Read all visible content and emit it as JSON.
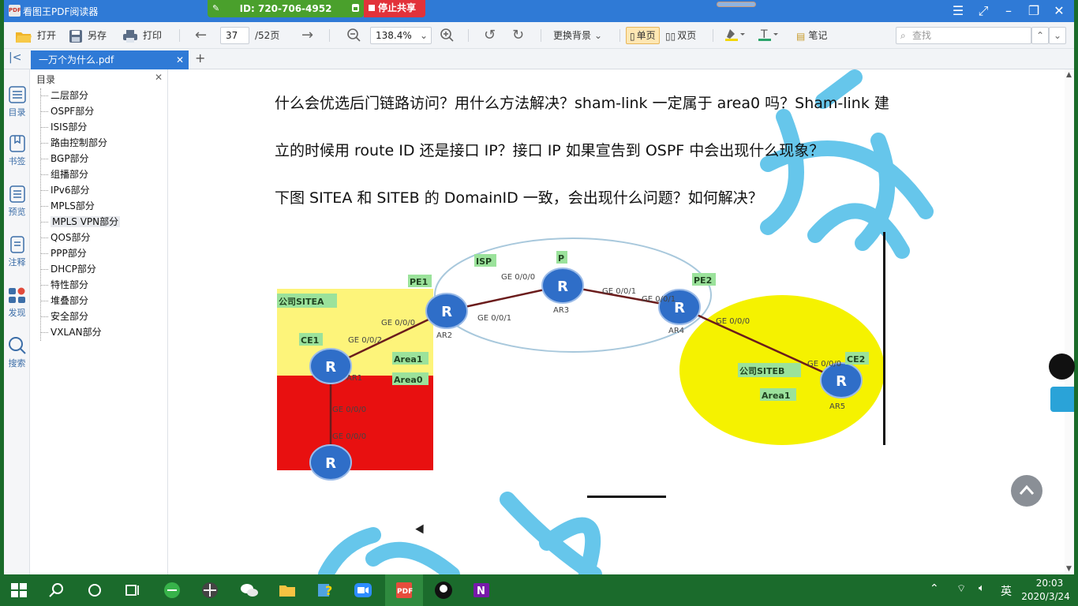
{
  "app": {
    "title": "看图王PDF阅读器",
    "logo_text": "PDF"
  },
  "share": {
    "id_label": "ID: 720-706-4952",
    "stop_label": "停止共享"
  },
  "toolbar": {
    "open": "打开",
    "save_as": "另存",
    "print": "打印",
    "page_current": "37",
    "page_total": "/52页",
    "zoom": "138.4%",
    "background": "更换背景",
    "single_page": "单页",
    "double_page": "双页",
    "notes": "笔记",
    "search_placeholder": "查找"
  },
  "tab": {
    "filename": "一万个为什么.pdf"
  },
  "sidebar": {
    "items": [
      "目录",
      "书签",
      "预览",
      "注释",
      "发现",
      "搜索"
    ]
  },
  "toc": {
    "title": "目录",
    "items": [
      "二层部分",
      "OSPF部分",
      "ISIS部分",
      "路由控制部分",
      "BGP部分",
      "组播部分",
      "IPv6部分",
      "MPLS部分",
      "MPLS VPN部分",
      "QOS部分",
      "PPP部分",
      "DHCP部分",
      "特性部分",
      "堆叠部分",
      "安全部分",
      "VXLAN部分"
    ],
    "selected_index": 8
  },
  "page": {
    "line1": "什么会优选后门链路访问？用什么方法解决？sham-link 一定属于 area0 吗？Sham-link 建",
    "line2": "立的时候用 route ID 还是接口 IP？接口 IP 如果宣告到 OSPF 中会出现什么现象？",
    "line3": "下图 SITEA 和 SITEB 的 DomainID 一致，会出现什么问题？如何解决？"
  },
  "diagram": {
    "isp": "ISP",
    "p": "P",
    "pe1": "PE1",
    "pe2": "PE2",
    "ce1": "CE1",
    "ce2": "CE2",
    "site_a": "公司SITEA",
    "site_b": "公司SITEB",
    "area1_a": "Area1",
    "area0_a": "Area0",
    "area1_b": "Area1",
    "ar1": "AR1",
    "ar2": "AR2",
    "ar3": "AR3",
    "ar4": "AR4",
    "ar5": "AR5",
    "ge1": "GE 0/0/0",
    "ge2": "GE 0/0/2",
    "ge3": "GE 0/0/0",
    "ge4": "GE 0/0/1",
    "ge5": "GE 0/0/0",
    "ge6": "GE 0/0/1",
    "ge7": "GE 0/0/1",
    "ge8": "GE 0/0/0",
    "ge9": "GE 0/0/0",
    "ge10": "GE 0/0/0",
    "ge11": "GE 0/0/0"
  },
  "taskbar": {
    "time": "20:03",
    "date": "2020/3/24",
    "ime": "英"
  },
  "colors": {
    "titlebar": "#2f7ad6",
    "taskbar": "#1b6b2c",
    "stop_share": "#e2323a",
    "share_id": "#4aa02c"
  }
}
